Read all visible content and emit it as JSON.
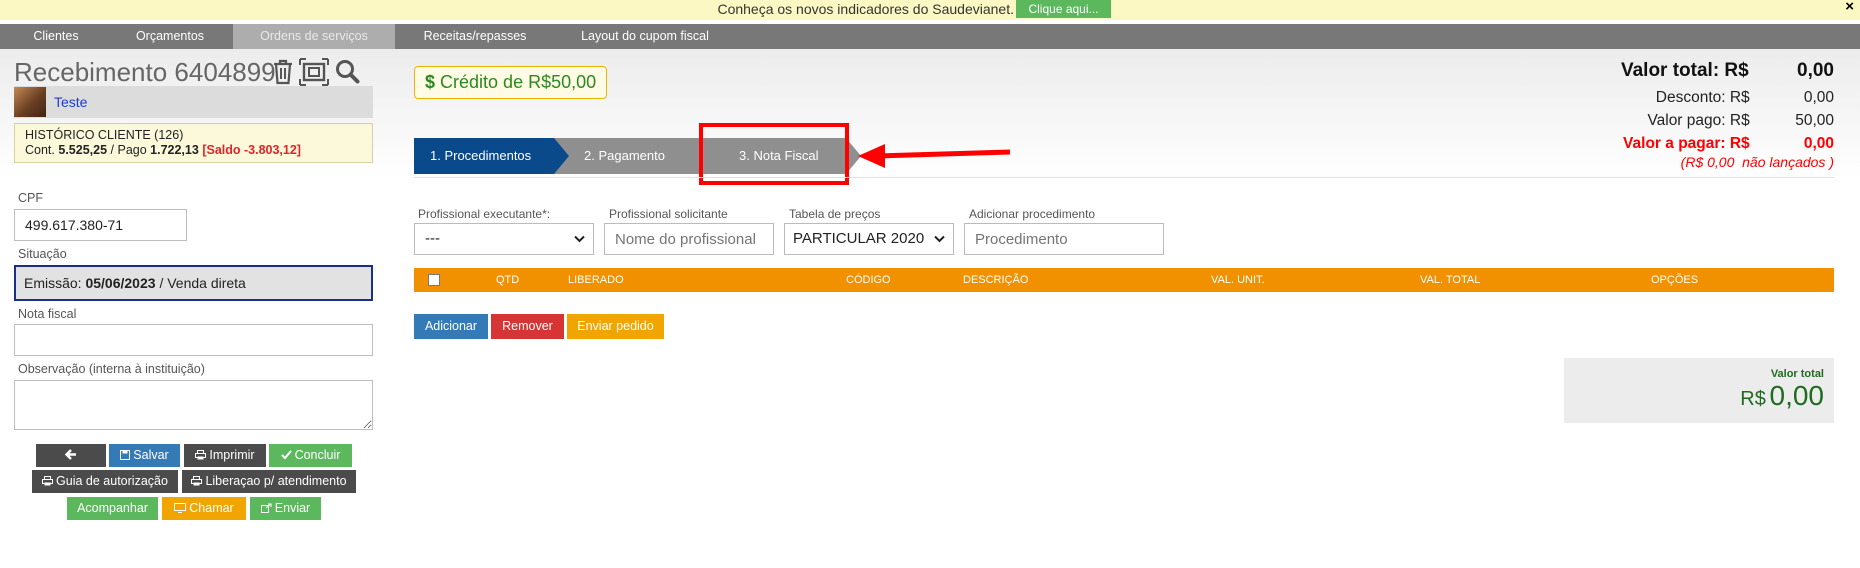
{
  "banner": {
    "text": "Conheça os novos indicadores do Saudevianet.",
    "button": "Clique aqui...",
    "close": "×"
  },
  "nav": {
    "items": [
      "Clientes",
      "Orçamentos",
      "Ordens de serviços",
      "Receitas/repasses",
      "Layout do cupom fiscal"
    ],
    "active_index": 2
  },
  "header": {
    "title": "Recebimento 6404899",
    "client_name": "Teste",
    "history": {
      "title": "HISTÓRICO CLIENTE (126)",
      "cont_label": "Cont.",
      "cont_value": "5.525,25",
      "pago_label": "/ Pago",
      "pago_value": "1.722,13",
      "saldo": "[Saldo -3.803,12]"
    }
  },
  "form": {
    "cpf_label": "CPF",
    "cpf_value": "499.617.380-71",
    "situacao_label": "Situação",
    "emissao_label": "Emissão:",
    "emissao_date": "05/06/2023",
    "venda": "/ Venda direta",
    "nota_label": "Nota fiscal",
    "obs_label": "Observação (interna à instituição)"
  },
  "actions": {
    "back": "",
    "salvar": "Salvar",
    "imprimir": "Imprimir",
    "concluir": "Concluir",
    "guia": "Guia de autorização",
    "liberacao": "Liberaçao p/ atendimento",
    "acompanhar": "Acompanhar",
    "chamar": "Chamar",
    "enviar": "Enviar"
  },
  "credit": "Crédito de R$50,00",
  "steps": [
    "1. Procedimentos",
    "2. Pagamento",
    "3. Nota Fiscal"
  ],
  "totals": {
    "valor_total_label": "Valor total: R$",
    "valor_total": "0,00",
    "desconto_label": "Desconto: R$",
    "desconto": "0,00",
    "valor_pago_label": "Valor pago: R$",
    "valor_pago": "50,00",
    "valor_pagar_label": "Valor a pagar: R$",
    "valor_pagar": "0,00",
    "nao_lancados": "(R$ 0,00  não lançados )"
  },
  "filters": {
    "prof_exec_label": "Profissional executante*:",
    "prof_exec_value": "---",
    "prof_sol_label": "Profissional solicitante",
    "prof_sol_placeholder": "Nome do profissional",
    "tabela_label": "Tabela de preços",
    "tabela_value": "PARTICULAR 2020",
    "proc_label": "Adicionar procedimento",
    "proc_placeholder": "Procedimento"
  },
  "table": {
    "columns": [
      "QTD",
      "LIBERADO",
      "CÓDIGO",
      "DESCRIÇÃO",
      "VAL. UNIT.",
      "VAL. TOTAL",
      "OPÇÕES"
    ]
  },
  "table_actions": {
    "adicionar": "Adicionar",
    "remover": "Remover",
    "enviar_pedido": "Enviar pedido"
  },
  "total_box": {
    "label": "Valor total",
    "currency": "R$",
    "value": "0,00"
  },
  "colors": {
    "accent_orange": "#f29100",
    "step_active": "#0a4a8a",
    "highlight": "#ff0000",
    "negative": "#e0242a",
    "credit_green": "#2a8a1f"
  }
}
